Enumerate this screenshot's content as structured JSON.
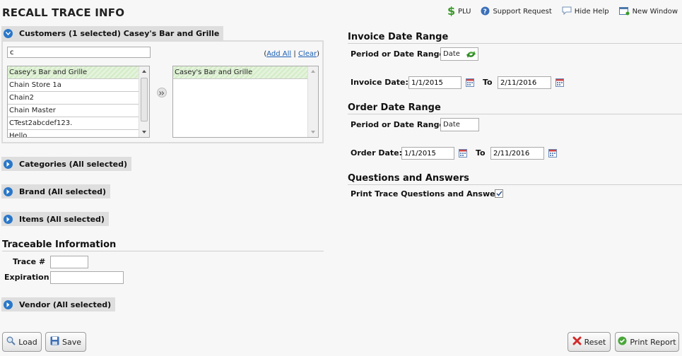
{
  "page": {
    "title": "RECALL TRACE INFO"
  },
  "top_links": [
    {
      "label": "PLU",
      "icon": "dollar-icon"
    },
    {
      "label": "Support Request",
      "icon": "help-icon"
    },
    {
      "label": "Hide Help",
      "icon": "speech-bubble-icon"
    },
    {
      "label": "New Window",
      "icon": "new-window-icon"
    }
  ],
  "customers": {
    "header": "Customers (1 selected) Casey's Bar and Grille",
    "search_value": "c",
    "open_paren": "(",
    "add_all": "Add All",
    "separator": "|",
    "clear": "Clear",
    "close_paren": ")",
    "available": [
      "Casey's Bar and Grille",
      "Chain Store 1a",
      "Chain2",
      "Chain Master",
      "CTest2abcdef123.",
      "Hello"
    ],
    "selected": [
      "Casey's Bar and Grille"
    ]
  },
  "sections": {
    "categories": "Categories (All selected)",
    "brand": "Brand (All selected)",
    "items": "Items (All selected)",
    "vendor": "Vendor (All selected)"
  },
  "traceable": {
    "title": "Traceable Information",
    "trace_label": "Trace #",
    "trace_value": "",
    "expiration_label": "Expiration",
    "expiration_value": ""
  },
  "invoice": {
    "title": "Invoice Date Range",
    "period_label": "Period or Date Range",
    "period_value": "Date",
    "date_label": "Invoice Date:",
    "from": "1/1/2015",
    "to_label": "To",
    "to": "2/11/2016"
  },
  "order": {
    "title": "Order Date Range",
    "period_label": "Period or Date Range",
    "period_value": "Date",
    "date_label": "Order Date:",
    "from": "1/1/2015",
    "to_label": "To",
    "to": "2/11/2016"
  },
  "qa": {
    "title": "Questions and Answers",
    "print_label": "Print Trace Questions and Answers",
    "checked": true
  },
  "buttons": {
    "load": "Load",
    "save": "Save",
    "reset": "Reset",
    "print": "Print Report"
  },
  "colors": {
    "accent": "#2a77c9",
    "link": "#1a5fb4",
    "selected_row": "#d3ecc6"
  }
}
